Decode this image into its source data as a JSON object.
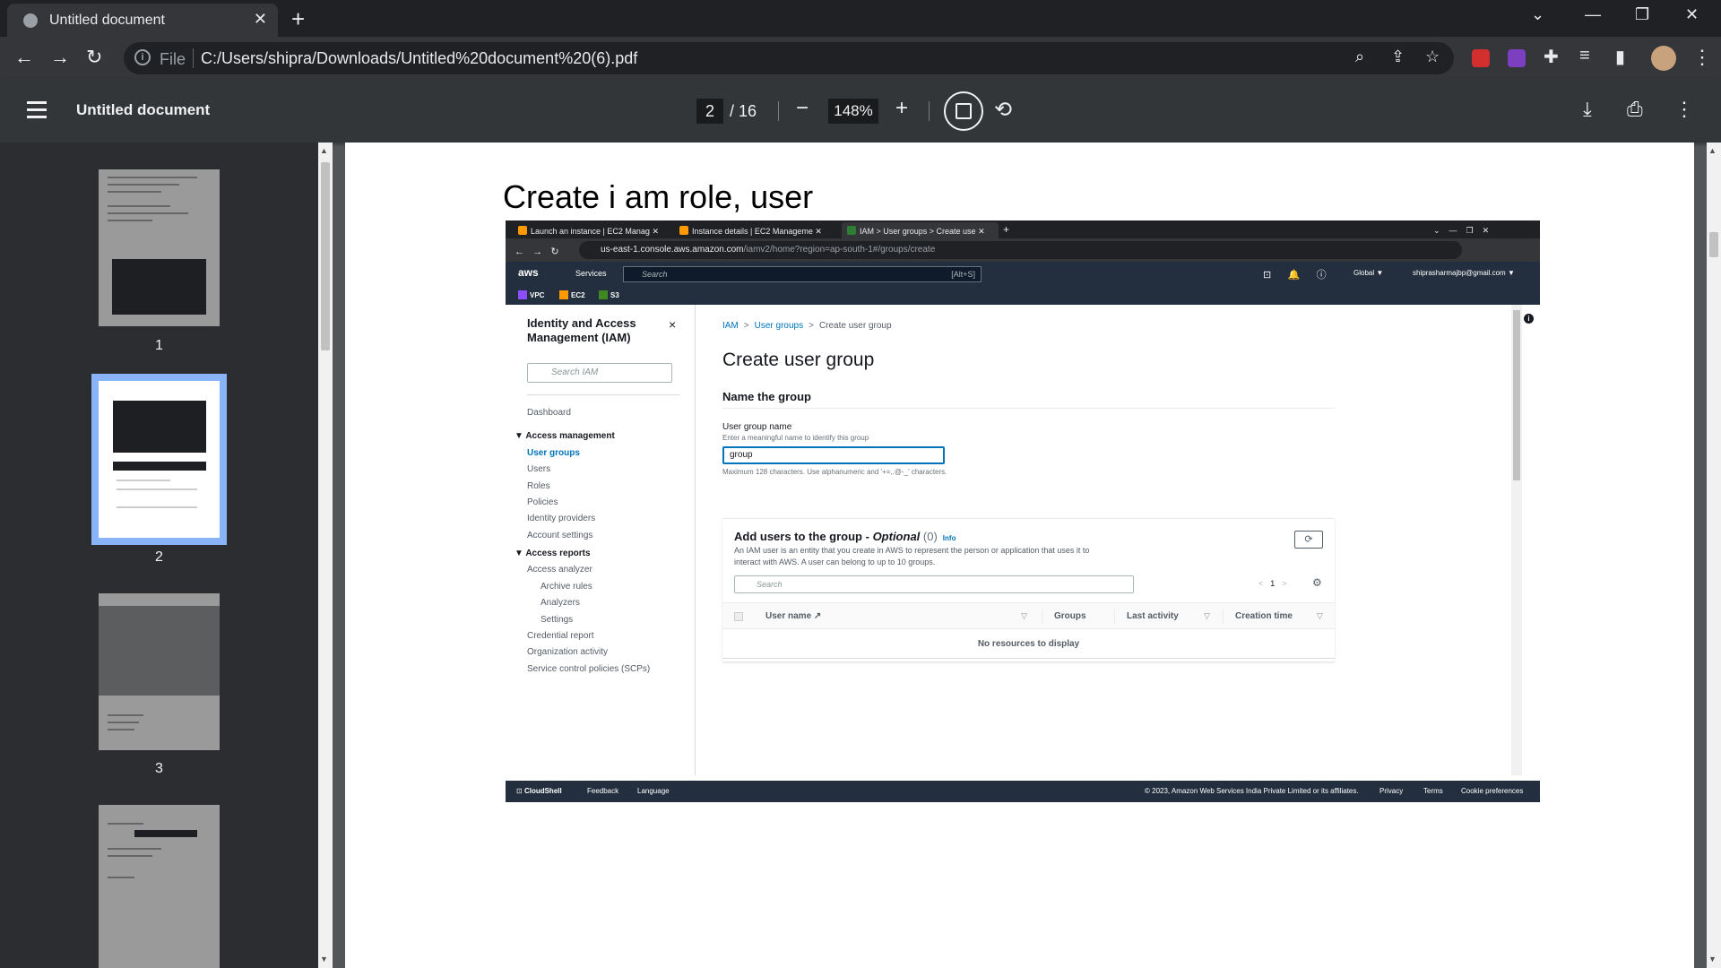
{
  "browser": {
    "tab_title": "Untitled document",
    "new_tab": "+",
    "scheme": "File",
    "url": "C:/Users/shipra/Downloads/Untitled%20document%20(6).pdf"
  },
  "viewer": {
    "doc_title": "Untitled document",
    "current_page": "2",
    "total_pages": "/ 16",
    "zoom": "148%",
    "zoom_out": "−",
    "zoom_in": "+"
  },
  "thumbnails": [
    {
      "num": "1"
    },
    {
      "num": "2"
    },
    {
      "num": "3"
    }
  ],
  "page": {
    "heading": "Create i am role, user"
  },
  "shot": {
    "tabs": [
      "Launch an instance | EC2 Manag",
      "Instance details | EC2 Manageme",
      "IAM > User groups > Create use"
    ],
    "new_tab": "+",
    "url_host": "us-east-1.console.aws.amazon.com",
    "url_path": "/iamv2/home?region=ap-south-1#/groups/create",
    "aws_logo": "aws",
    "services": "Services",
    "search_placeholder": "Search",
    "search_kbd": "[Alt+S]",
    "region": "Global ▼",
    "account": "shiprasharmajbp@gmail.com ▼",
    "favorites": [
      "VPC",
      "EC2",
      "S3"
    ],
    "side_heading": "Identity and Access Management (IAM)",
    "side_close": "×",
    "side_search": "Search IAM",
    "dashboard": "Dashboard",
    "access_management": "Access management",
    "am_items": [
      "User groups",
      "Users",
      "Roles",
      "Policies",
      "Identity providers",
      "Account settings"
    ],
    "access_reports": "Access reports",
    "ar_items": [
      "Access analyzer",
      "Archive rules",
      "Analyzers",
      "Settings",
      "Credential report",
      "Organization activity",
      "Service control policies (SCPs)"
    ],
    "crumb_iam": "IAM",
    "crumb_groups": "User groups",
    "crumb_current": "Create user group",
    "chevron": ">",
    "title": "Create user group",
    "name_section": "Name the group",
    "field_label": "User group name",
    "field_hint": "Enter a meaningful name to identify this group",
    "field_value": "group",
    "field_constraint": "Maximum 128 characters. Use alphanumeric and '+=,.@-_' characters.",
    "panel_title": "Add users to the group - ",
    "panel_optional": "Optional",
    "panel_count": "(0)",
    "panel_info": "Info",
    "panel_desc": "An IAM user is an entity that you create in AWS to represent the person or application that uses it to interact with AWS. A user can belong to up to 10 groups.",
    "panel_search": "Search",
    "page_num": "1",
    "columns": [
      "User name",
      "Groups",
      "Last activity",
      "Creation time"
    ],
    "empty": "No resources to display",
    "footer_left": [
      "CloudShell",
      "Feedback",
      "Language"
    ],
    "footer_copy": "© 2023, Amazon Web Services India Private Limited or its affiliates.",
    "footer_right": [
      "Privacy",
      "Terms",
      "Cookie preferences"
    ]
  },
  "colors": {
    "accent": "#8ab4f8",
    "aws_nav": "#232f3e",
    "aws_link": "#0073bb"
  }
}
